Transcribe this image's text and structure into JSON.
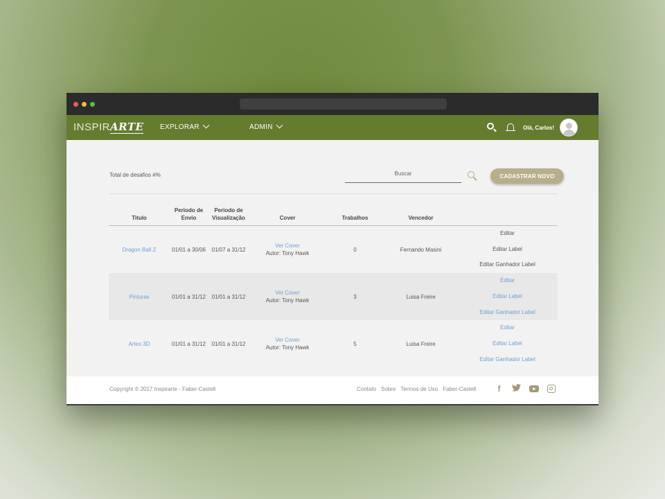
{
  "app": {
    "logo_prefix": "INSPIR",
    "logo_suffix": "ARTE"
  },
  "navbar": {
    "explorar": "EXPLORAR",
    "admin": "ADMIN",
    "greeting": "Olá, Carlos!"
  },
  "toolbar": {
    "total_label": "Total de desafios #%",
    "search_placeholder": "Buscar",
    "new_button": "CADASTRAR NOVO"
  },
  "table": {
    "headers": {
      "titulo": "Titulo",
      "envio_line1": "Periodo de",
      "envio_line2": "Envio",
      "vis_line1": "Periodo de",
      "vis_line2": "Visualização",
      "cover": "Cover",
      "trabalhos": "Trabalhos",
      "vencedor": "Vencedor"
    },
    "rows": [
      {
        "titulo": "Dragon Ball Z",
        "envio": "01/01 a 30/06",
        "visualizacao": "01/07 a 31/12",
        "cover_link": "Ver Cover",
        "cover_author": "Autor: Tony Hawk",
        "trabalhos": "0",
        "vencedor": "Fernando Masini",
        "acao1": "Editar",
        "acao2": "Editar Label",
        "acao3": "Editar Ganhador Label"
      },
      {
        "titulo": "Pinturas",
        "envio": "01/01 a 31/12",
        "visualizacao": "01/01 a 31/12",
        "cover_link": "Ver Cover",
        "cover_author": "Autor: Tony Hawk",
        "trabalhos": "3",
        "vencedor": "Luisa Freire",
        "acao1": "Editar",
        "acao2": "Editar Label",
        "acao3": "Editar Ganhador Label"
      },
      {
        "titulo": "Artes 3D",
        "envio": "01/01 a 31/12",
        "visualizacao": "01/01 a 31/12",
        "cover_link": "Ver Cover",
        "cover_author": "Autor: Tony Hawk",
        "trabalhos": "5",
        "vencedor": "Luisa Freire",
        "acao1": "Editar",
        "acao2": "Editar Label",
        "acao3": "Editar Ganhador Label"
      }
    ]
  },
  "footer": {
    "copyright": "Copyright © 2017 Inspirarte - Faber-Castell",
    "links": [
      "Contato",
      "Sobre",
      "Termos de Uso",
      "Faber-Castell"
    ],
    "facebook_glyph": "f",
    "twitter_glyph": "🐦"
  },
  "colors": {
    "navbar": "#637c2e",
    "accent_button": "#b8ae8a",
    "link": "#6da0d6"
  },
  "icons": [
    "search-icon",
    "bell-icon",
    "avatar",
    "facebook-icon",
    "twitter-icon",
    "youtube-icon",
    "instagram-icon"
  ]
}
